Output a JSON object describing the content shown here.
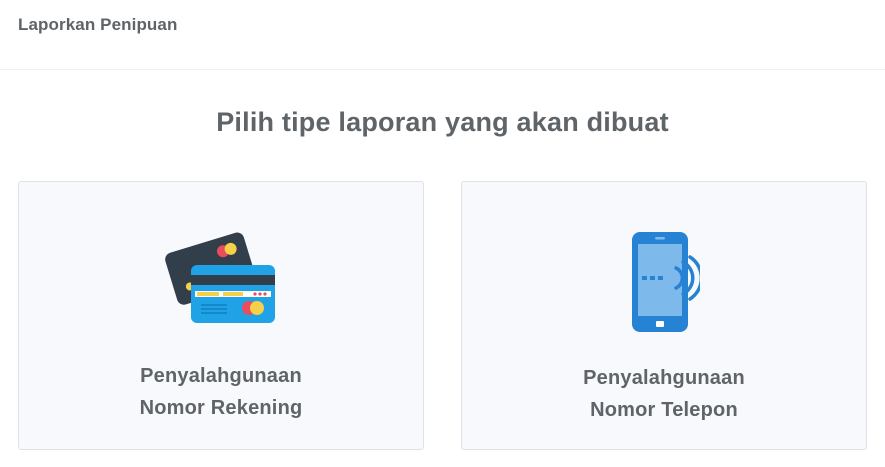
{
  "header": {
    "title": "Laporkan Penipuan"
  },
  "main": {
    "heading": "Pilih tipe laporan yang akan dibuat",
    "options": [
      {
        "icon": "credit-cards-icon",
        "label_line1": "Penyalahgunaan",
        "label_line2": "Nomor Rekening"
      },
      {
        "icon": "mobile-phone-icon",
        "label_line1": "Penyalahgunaan",
        "label_line2": "Nomor Telepon"
      }
    ]
  },
  "colors": {
    "text": "#5f6468",
    "card_background": "#f8f9fd",
    "card_border": "#dfe2e6",
    "dark_card": "#323e4a",
    "blue_card": "#1fa2e6",
    "phone_blue": "#2682d2",
    "phone_screen": "#7eb9ec",
    "accent_yellow": "#f7d04a",
    "accent_red": "#e84c5d"
  }
}
